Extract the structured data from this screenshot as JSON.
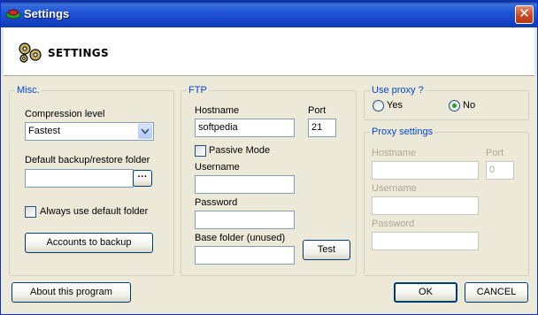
{
  "window": {
    "title": "Settings",
    "close_glyph": "✕"
  },
  "header": {
    "title": "SETTINGS",
    "icon": "gears-icon"
  },
  "misc": {
    "legend": "Misc.",
    "compression_label": "Compression level",
    "compression_value": "Fastest",
    "folder_label": "Default backup/restore folder",
    "folder_value": "",
    "browse_label": "···",
    "always_default_label": "Always use default folder",
    "always_default_checked": false,
    "accounts_button": "Accounts to backup"
  },
  "ftp": {
    "legend": "FTP",
    "hostname_label": "Hostname",
    "hostname_value": "softpedia",
    "port_label": "Port",
    "port_value": "21",
    "passive_label": "Passive Mode",
    "passive_checked": false,
    "username_label": "Username",
    "username_value": "",
    "password_label": "Password",
    "password_value": "",
    "base_folder_label": "Base folder (unused)",
    "base_folder_value": "",
    "test_button": "Test"
  },
  "proxy": {
    "legend": "Use proxy ?",
    "yes_label": "Yes",
    "no_label": "No",
    "selected": "No"
  },
  "proxy_settings": {
    "legend": "Proxy settings",
    "hostname_label": "Hostname",
    "hostname_value": "",
    "port_label": "Port",
    "port_value": "0",
    "username_label": "Username",
    "username_value": "",
    "password_label": "Password",
    "password_value": ""
  },
  "footer": {
    "about_button": "About this program",
    "ok_button": "OK",
    "cancel_button": "CANCEL"
  },
  "colors": {
    "titlebar": "#2257d5",
    "dialog_bg": "#ece9d8",
    "group_legend": "#0046d5",
    "close_button": "#c8451f"
  }
}
